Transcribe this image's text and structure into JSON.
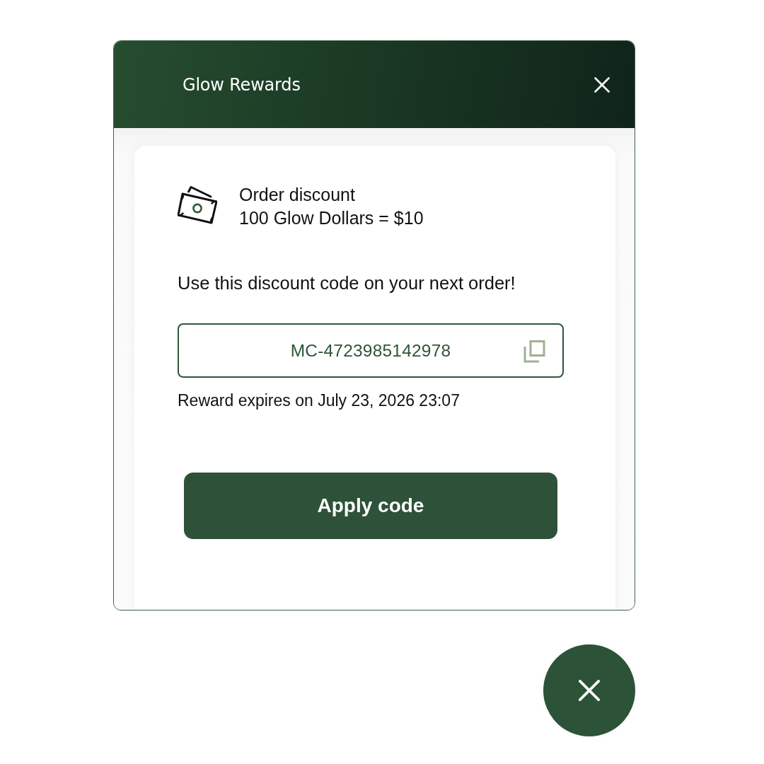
{
  "panel": {
    "title": "Glow Rewards"
  },
  "reward": {
    "name": "Order discount",
    "rate": "100 Glow Dollars = $10"
  },
  "instruction": "Use this discount code on your next order!",
  "code_field": {
    "value": "MC-4723985142978"
  },
  "expiry": "Reward expires on July 23, 2026 23:07",
  "apply_button": {
    "label": "Apply code"
  }
}
